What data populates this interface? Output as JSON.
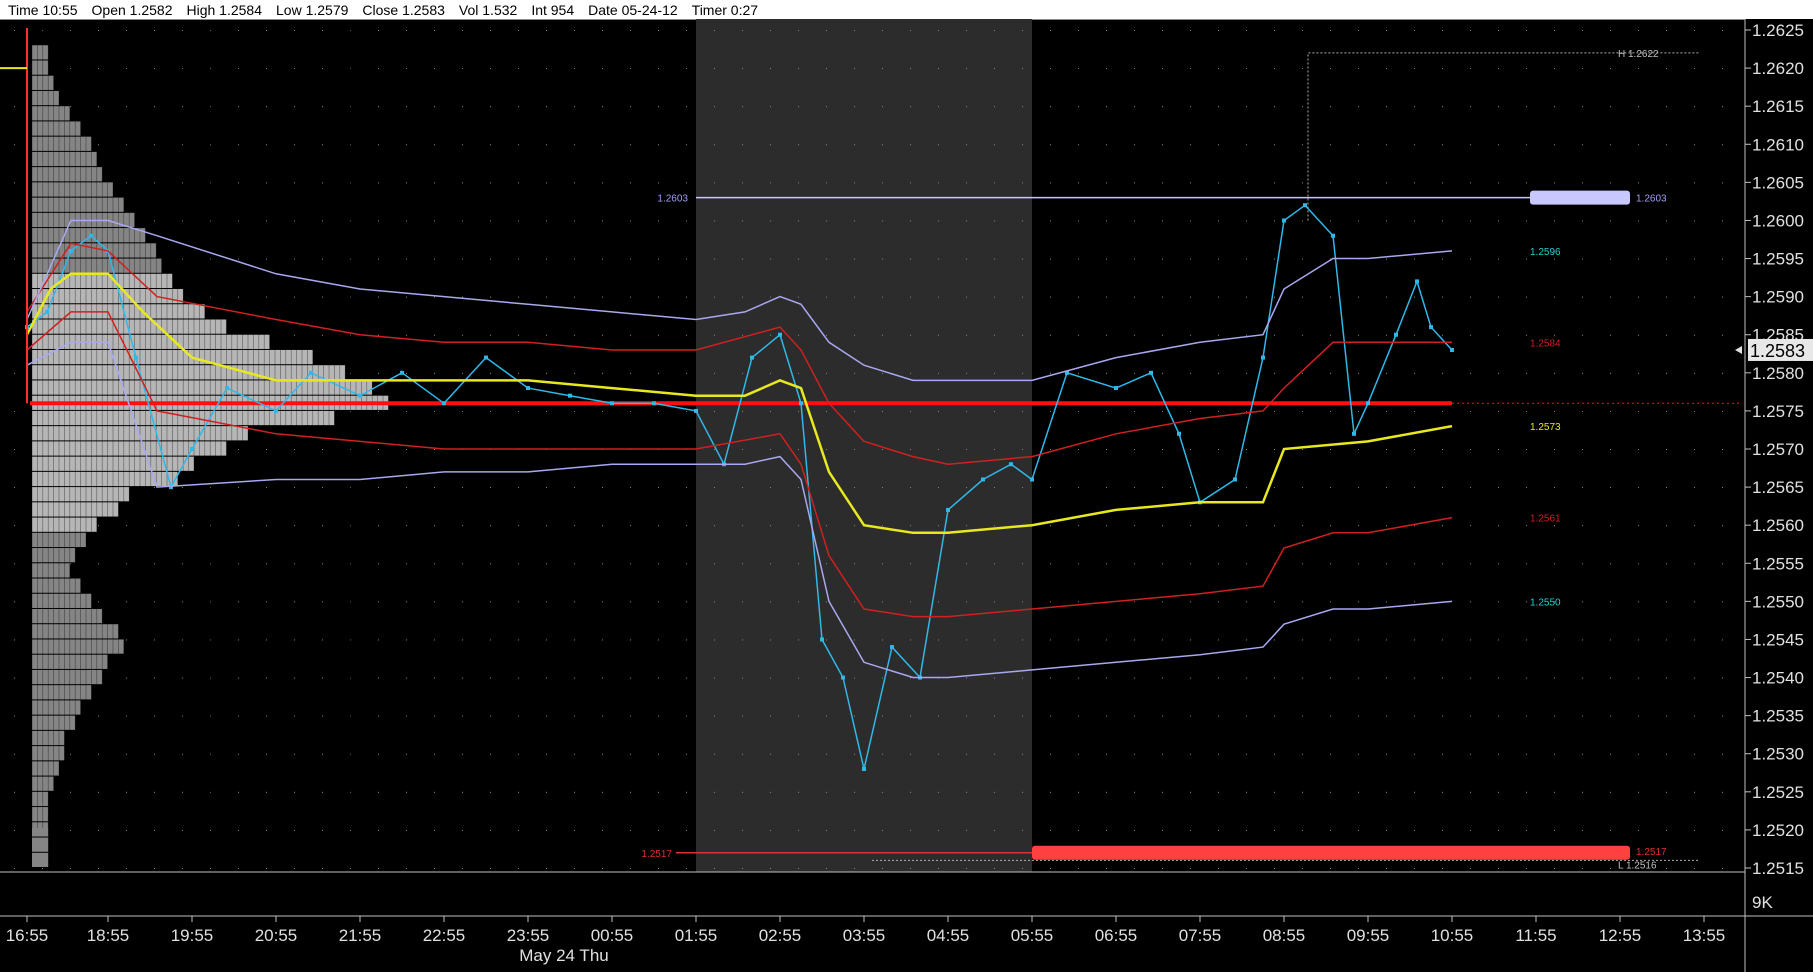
{
  "header": {
    "fields": [
      "Time 10:55",
      "Open 1.2582",
      "High 1.2584",
      "Low 1.2579",
      "Close 1.2583",
      "Vol 1.532",
      "Int 954",
      "Date 05-24-12",
      "Timer 0:27"
    ]
  },
  "chart_data": {
    "type": "line",
    "ylim": [
      1.2515,
      1.2625
    ],
    "y_ticks": [
      "1.2515",
      "1.2520",
      "1.2525",
      "1.2530",
      "1.2535",
      "1.2540",
      "1.2545",
      "1.2550",
      "1.2555",
      "1.2560",
      "1.2565",
      "1.2570",
      "1.2575",
      "1.2580",
      "1.2585",
      "1.2590",
      "1.2595",
      "1.2600",
      "1.2605",
      "1.2610",
      "1.2615",
      "1.2620",
      "1.2625"
    ],
    "x_ticks": [
      "16:55",
      "18:55",
      "19:55",
      "20:55",
      "21:55",
      "22:55",
      "23:55",
      "00:55",
      "01:55",
      "02:55",
      "03:55",
      "04:55",
      "05:55",
      "06:55",
      "07:55",
      "08:55",
      "09:55",
      "10:55",
      "11:55",
      "12:55",
      "13:55"
    ],
    "date_label": "May 24 Thu",
    "volume_label": "9K",
    "last_price": "1.2583",
    "last_price_value": 1.2583,
    "background_shade": {
      "from": "01:55",
      "to": "05:55"
    },
    "level_labels": [
      {
        "text": "1.2603",
        "value": 1.2603,
        "color": "#a0a0f0"
      },
      {
        "text": "1.2517",
        "value": 1.2517,
        "color": "#e03030"
      }
    ],
    "high_marker": {
      "text": "H 1.2622",
      "value": 1.2622
    },
    "low_marker": {
      "text": "L 1.2516",
      "value": 1.2516
    },
    "band_end_labels": [
      {
        "text": "1.2596",
        "value": 1.2596,
        "color": "#20d0d0"
      },
      {
        "text": "1.2584",
        "value": 1.2584,
        "color": "#d02020"
      },
      {
        "text": "1.2573",
        "value": 1.2573,
        "color": "#e8e820"
      },
      {
        "text": "1.2561",
        "value": 1.2561,
        "color": "#d02020"
      },
      {
        "text": "1.2550",
        "value": 1.255,
        "color": "#20d0d0"
      }
    ],
    "poc_value": 1.2576,
    "series": [
      {
        "color": "#30b8e8",
        "points": [
          [
            "16:55",
            1.2586
          ],
          [
            "17:25",
            1.2588
          ],
          [
            "18:00",
            1.2596
          ],
          [
            "18:30",
            1.2598
          ],
          [
            "18:55",
            1.2596
          ],
          [
            "19:15",
            1.2582
          ],
          [
            "19:40",
            1.2565
          ],
          [
            "19:55",
            1.257
          ],
          [
            "20:20",
            1.2578
          ],
          [
            "20:55",
            1.2575
          ],
          [
            "21:20",
            1.258
          ],
          [
            "21:55",
            1.2577
          ],
          [
            "22:25",
            1.258
          ],
          [
            "22:55",
            1.2576
          ],
          [
            "23:25",
            1.2582
          ],
          [
            "23:55",
            1.2578
          ],
          [
            "00:25",
            1.2577
          ],
          [
            "00:55",
            1.2576
          ],
          [
            "01:25",
            1.2576
          ],
          [
            "01:55",
            1.2575
          ],
          [
            "02:15",
            1.2568
          ],
          [
            "02:35",
            1.2582
          ],
          [
            "02:55",
            1.2585
          ],
          [
            "03:10",
            1.2576
          ],
          [
            "03:25",
            1.2545
          ],
          [
            "03:40",
            1.254
          ],
          [
            "03:55",
            1.2528
          ],
          [
            "04:15",
            1.2544
          ],
          [
            "04:35",
            1.254
          ],
          [
            "04:55",
            1.2562
          ],
          [
            "05:20",
            1.2566
          ],
          [
            "05:40",
            1.2568
          ],
          [
            "05:55",
            1.2566
          ],
          [
            "06:20",
            1.258
          ],
          [
            "06:55",
            1.2578
          ],
          [
            "07:20",
            1.258
          ],
          [
            "07:40",
            1.2572
          ],
          [
            "07:55",
            1.2563
          ],
          [
            "08:20",
            1.2566
          ],
          [
            "08:40",
            1.2582
          ],
          [
            "08:55",
            1.26
          ],
          [
            "09:10",
            1.2602
          ],
          [
            "09:30",
            1.2598
          ],
          [
            "09:45",
            1.2572
          ],
          [
            "09:55",
            1.2576
          ],
          [
            "10:15",
            1.2585
          ],
          [
            "10:30",
            1.2592
          ],
          [
            "10:40",
            1.2586
          ],
          [
            "10:55",
            1.2583
          ]
        ]
      },
      {
        "color": "#e8e820",
        "points": [
          [
            "16:55",
            1.2585
          ],
          [
            "17:30",
            1.2591
          ],
          [
            "18:00",
            1.2593
          ],
          [
            "18:55",
            1.2593
          ],
          [
            "19:20",
            1.2588
          ],
          [
            "19:55",
            1.2582
          ],
          [
            "20:55",
            1.2579
          ],
          [
            "21:55",
            1.2579
          ],
          [
            "22:55",
            1.2579
          ],
          [
            "23:55",
            1.2579
          ],
          [
            "00:55",
            1.2578
          ],
          [
            "01:55",
            1.2577
          ],
          [
            "02:30",
            1.2577
          ],
          [
            "02:55",
            1.2579
          ],
          [
            "03:10",
            1.2578
          ],
          [
            "03:30",
            1.2567
          ],
          [
            "03:55",
            1.256
          ],
          [
            "04:30",
            1.2559
          ],
          [
            "04:55",
            1.2559
          ],
          [
            "05:55",
            1.256
          ],
          [
            "06:55",
            1.2562
          ],
          [
            "07:55",
            1.2563
          ],
          [
            "08:40",
            1.2563
          ],
          [
            "08:55",
            1.257
          ],
          [
            "09:55",
            1.2571
          ],
          [
            "10:55",
            1.2573
          ]
        ]
      },
      {
        "color": "#d02020",
        "points": [
          [
            "16:55",
            1.2588
          ],
          [
            "18:00",
            1.2597
          ],
          [
            "18:55",
            1.2596
          ],
          [
            "19:30",
            1.259
          ],
          [
            "20:55",
            1.2587
          ],
          [
            "21:55",
            1.2585
          ],
          [
            "22:55",
            1.2584
          ],
          [
            "23:55",
            1.2584
          ],
          [
            "00:55",
            1.2583
          ],
          [
            "01:55",
            1.2583
          ],
          [
            "02:55",
            1.2586
          ],
          [
            "03:10",
            1.2583
          ],
          [
            "03:30",
            1.2576
          ],
          [
            "03:55",
            1.2571
          ],
          [
            "04:30",
            1.2569
          ],
          [
            "04:55",
            1.2568
          ],
          [
            "05:55",
            1.2569
          ],
          [
            "06:55",
            1.2572
          ],
          [
            "07:55",
            1.2574
          ],
          [
            "08:40",
            1.2575
          ],
          [
            "08:55",
            1.2578
          ],
          [
            "09:30",
            1.2584
          ],
          [
            "09:55",
            1.2584
          ],
          [
            "10:55",
            1.2584
          ]
        ]
      },
      {
        "color": "#d02020",
        "points": [
          [
            "16:55",
            1.2583
          ],
          [
            "18:00",
            1.2588
          ],
          [
            "18:55",
            1.2588
          ],
          [
            "19:30",
            1.2575
          ],
          [
            "20:55",
            1.2572
          ],
          [
            "21:55",
            1.2571
          ],
          [
            "22:55",
            1.257
          ],
          [
            "23:55",
            1.257
          ],
          [
            "00:55",
            1.257
          ],
          [
            "01:55",
            1.257
          ],
          [
            "02:55",
            1.2572
          ],
          [
            "03:10",
            1.2568
          ],
          [
            "03:30",
            1.2556
          ],
          [
            "03:55",
            1.2549
          ],
          [
            "04:30",
            1.2548
          ],
          [
            "04:55",
            1.2548
          ],
          [
            "05:55",
            1.2549
          ],
          [
            "06:55",
            1.255
          ],
          [
            "07:55",
            1.2551
          ],
          [
            "08:40",
            1.2552
          ],
          [
            "08:55",
            1.2557
          ],
          [
            "09:30",
            1.2559
          ],
          [
            "09:55",
            1.2559
          ],
          [
            "10:55",
            1.2561
          ]
        ]
      },
      {
        "color": "#a8a8f0",
        "points": [
          [
            "16:55",
            1.2587
          ],
          [
            "18:00",
            1.26
          ],
          [
            "18:55",
            1.26
          ],
          [
            "19:30",
            1.2598
          ],
          [
            "20:55",
            1.2593
          ],
          [
            "21:55",
            1.2591
          ],
          [
            "22:55",
            1.259
          ],
          [
            "23:55",
            1.2589
          ],
          [
            "00:55",
            1.2588
          ],
          [
            "01:55",
            1.2587
          ],
          [
            "02:30",
            1.2588
          ],
          [
            "02:55",
            1.259
          ],
          [
            "03:10",
            1.2589
          ],
          [
            "03:30",
            1.2584
          ],
          [
            "03:55",
            1.2581
          ],
          [
            "04:30",
            1.2579
          ],
          [
            "04:55",
            1.2579
          ],
          [
            "05:55",
            1.2579
          ],
          [
            "06:55",
            1.2582
          ],
          [
            "07:55",
            1.2584
          ],
          [
            "08:40",
            1.2585
          ],
          [
            "08:55",
            1.2591
          ],
          [
            "09:30",
            1.2595
          ],
          [
            "09:55",
            1.2595
          ],
          [
            "10:55",
            1.2596
          ]
        ]
      },
      {
        "color": "#a8a8f0",
        "points": [
          [
            "16:55",
            1.2581
          ],
          [
            "18:00",
            1.2584
          ],
          [
            "18:55",
            1.2584
          ],
          [
            "19:30",
            1.2565
          ],
          [
            "20:55",
            1.2566
          ],
          [
            "21:55",
            1.2566
          ],
          [
            "22:55",
            1.2567
          ],
          [
            "23:55",
            1.2567
          ],
          [
            "00:55",
            1.2568
          ],
          [
            "01:55",
            1.2568
          ],
          [
            "02:30",
            1.2568
          ],
          [
            "02:55",
            1.2569
          ],
          [
            "03:10",
            1.2566
          ],
          [
            "03:30",
            1.255
          ],
          [
            "03:55",
            1.2542
          ],
          [
            "04:30",
            1.254
          ],
          [
            "04:55",
            1.254
          ],
          [
            "05:55",
            1.2541
          ],
          [
            "06:55",
            1.2542
          ],
          [
            "07:55",
            1.2543
          ],
          [
            "08:40",
            1.2544
          ],
          [
            "08:55",
            1.2547
          ],
          [
            "09:30",
            1.2549
          ],
          [
            "09:55",
            1.2549
          ],
          [
            "10:55",
            1.255
          ]
        ]
      }
    ],
    "profile": {
      "color": "#b8b8b8",
      "bins": [
        [
          1.2622,
          3
        ],
        [
          1.262,
          3
        ],
        [
          1.2618,
          4
        ],
        [
          1.2616,
          5
        ],
        [
          1.2614,
          7
        ],
        [
          1.2612,
          9
        ],
        [
          1.261,
          11
        ],
        [
          1.2608,
          12
        ],
        [
          1.2606,
          13
        ],
        [
          1.2604,
          15
        ],
        [
          1.2602,
          17
        ],
        [
          1.26,
          19
        ],
        [
          1.2598,
          21
        ],
        [
          1.2596,
          23
        ],
        [
          1.2594,
          24
        ],
        [
          1.2592,
          26
        ],
        [
          1.259,
          28
        ],
        [
          1.2588,
          32
        ],
        [
          1.2586,
          36
        ],
        [
          1.2584,
          44
        ],
        [
          1.2582,
          52
        ],
        [
          1.258,
          58
        ],
        [
          1.2578,
          63
        ],
        [
          1.2576,
          66
        ],
        [
          1.2574,
          56
        ],
        [
          1.2572,
          40
        ],
        [
          1.257,
          36
        ],
        [
          1.2568,
          30
        ],
        [
          1.2566,
          27
        ],
        [
          1.2564,
          18
        ],
        [
          1.2562,
          16
        ],
        [
          1.256,
          12
        ],
        [
          1.2558,
          10
        ],
        [
          1.2556,
          8
        ],
        [
          1.2554,
          7
        ],
        [
          1.2552,
          9
        ],
        [
          1.255,
          11
        ],
        [
          1.2548,
          13
        ],
        [
          1.2546,
          16
        ],
        [
          1.2544,
          17
        ],
        [
          1.2542,
          14
        ],
        [
          1.254,
          13
        ],
        [
          1.2538,
          11
        ],
        [
          1.2536,
          9
        ],
        [
          1.2534,
          8
        ],
        [
          1.2532,
          6
        ],
        [
          1.253,
          6
        ],
        [
          1.2528,
          5
        ],
        [
          1.2526,
          4
        ],
        [
          1.2524,
          3
        ],
        [
          1.2522,
          3
        ],
        [
          1.252,
          3
        ],
        [
          1.2518,
          3
        ],
        [
          1.2516,
          3
        ]
      ]
    }
  }
}
